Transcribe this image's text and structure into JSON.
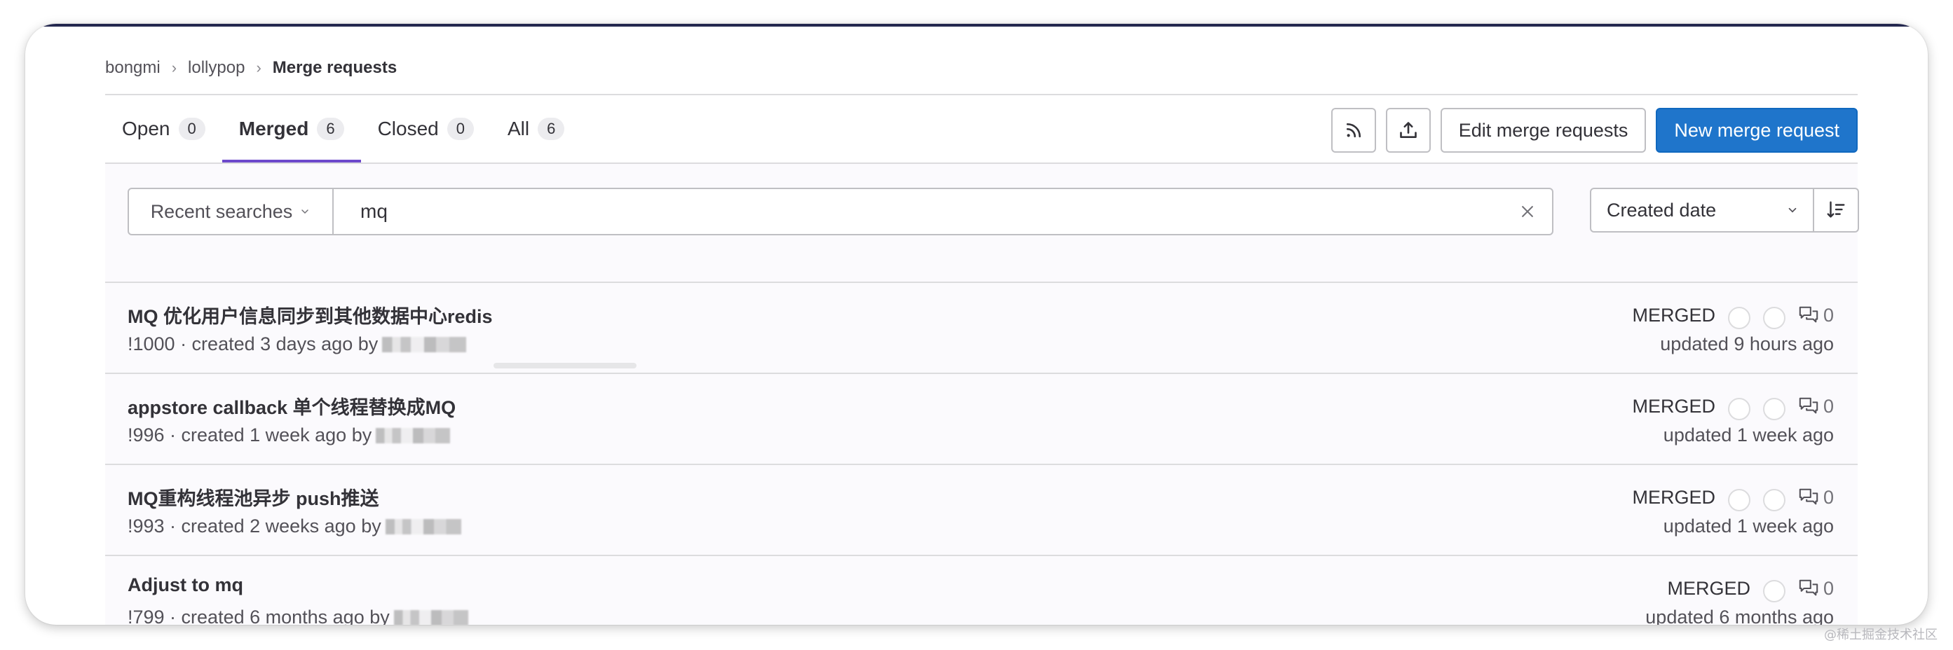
{
  "breadcrumb": {
    "items": [
      "bongmi",
      "lollypop"
    ],
    "current": "Merge requests"
  },
  "tabs": [
    {
      "label": "Open",
      "count": "0"
    },
    {
      "label": "Merged",
      "count": "6",
      "active": true
    },
    {
      "label": "Closed",
      "count": "0"
    },
    {
      "label": "All",
      "count": "6"
    }
  ],
  "actions": {
    "rss_icon": "rss-icon",
    "export_icon": "export-icon",
    "edit_label": "Edit merge requests",
    "new_label": "New merge request"
  },
  "filter": {
    "recent_label": "Recent searches",
    "search_value": "mq",
    "sort_label": "Created date"
  },
  "merge_requests": [
    {
      "title": "MQ 优化用户信息同步到其他数据中心redis",
      "meta": "!1000 · created 3 days ago by",
      "status": "MERGED",
      "comments": "0",
      "updated": "updated 9 hours ago",
      "circles": 2
    },
    {
      "title": "appstore callback 单个线程替换成MQ",
      "meta": "!996 · created 1 week ago by",
      "status": "MERGED",
      "comments": "0",
      "updated": "updated 1 week ago",
      "circles": 2
    },
    {
      "title": "MQ重构线程池异步 push推送",
      "meta": "!993 · created 2 weeks ago by",
      "status": "MERGED",
      "comments": "0",
      "updated": "updated 1 week ago",
      "circles": 2
    },
    {
      "title": "Adjust to mq",
      "meta": "!799 · created 6 months ago by",
      "status": "MERGED",
      "comments": "0",
      "updated": "updated 6 months ago",
      "circles": 1
    }
  ],
  "watermark": "@稀土掘金技术社区",
  "colors": {
    "primary": "#1f75cb",
    "active_tab": "#6d49cb",
    "top_bar": "#24284f"
  }
}
